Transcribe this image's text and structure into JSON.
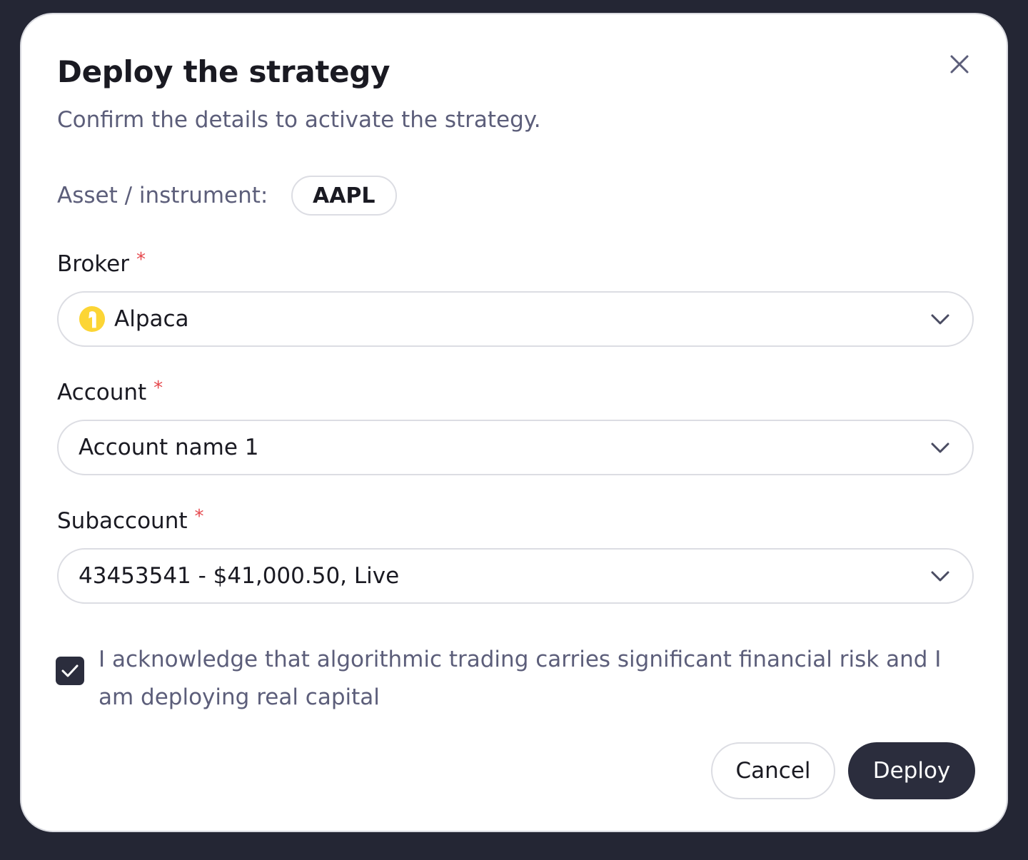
{
  "dialog": {
    "title": "Deploy the strategy",
    "subtitle": "Confirm the details to activate the strategy.",
    "close_icon": "close-icon"
  },
  "asset": {
    "label": "Asset / instrument:",
    "value": "AAPL"
  },
  "broker": {
    "label": "Broker",
    "required_mark": "*",
    "value": "Alpaca",
    "logo_icon": "alpaca-logo-icon",
    "logo_color": "#FCD535"
  },
  "account": {
    "label": "Account",
    "required_mark": "*",
    "value": "Account name 1"
  },
  "subaccount": {
    "label": "Subaccount",
    "required_mark": "*",
    "value": "43453541 - $41,000.50, Live"
  },
  "acknowledge": {
    "checked": true,
    "text": "I acknowledge that algorithmic trading carries significant financial risk and I am deploying real capital"
  },
  "actions": {
    "cancel_label": "Cancel",
    "deploy_label": "Deploy"
  },
  "colors": {
    "backdrop": "#242634",
    "primary": "#2B2D3D",
    "required": "#E5484D",
    "muted_text": "#5C5E7A"
  }
}
